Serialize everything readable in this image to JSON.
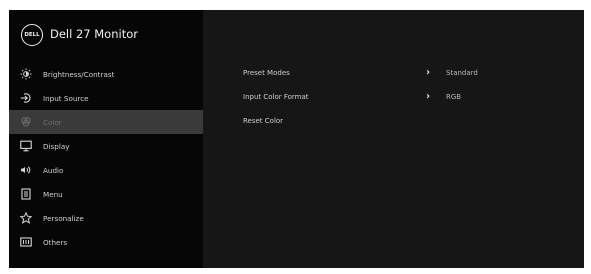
{
  "header": {
    "logo": "DELL",
    "title": "Dell 27 Monitor"
  },
  "sidebar": {
    "items": [
      {
        "icon": "brightness-icon",
        "label": "Brightness/Contrast"
      },
      {
        "icon": "input-source-icon",
        "label": "Input Source"
      },
      {
        "icon": "color-icon",
        "label": "Color"
      },
      {
        "icon": "display-icon",
        "label": "Display"
      },
      {
        "icon": "audio-icon",
        "label": "Audio"
      },
      {
        "icon": "menu-icon",
        "label": "Menu"
      },
      {
        "icon": "personalize-icon",
        "label": "Personalize"
      },
      {
        "icon": "others-icon",
        "label": "Others"
      }
    ],
    "selected": "Color"
  },
  "content": {
    "rows": [
      {
        "label": "Preset Modes",
        "value": "Standard"
      },
      {
        "label": "Input Color Format",
        "value": "RGB"
      },
      {
        "label": "Reset Color",
        "value": ""
      }
    ]
  },
  "colors": {
    "sidebar_bg": "#060606",
    "content_bg": "#161616",
    "selected_bg": "#3a3a3a",
    "text": "#cfcfcf"
  }
}
